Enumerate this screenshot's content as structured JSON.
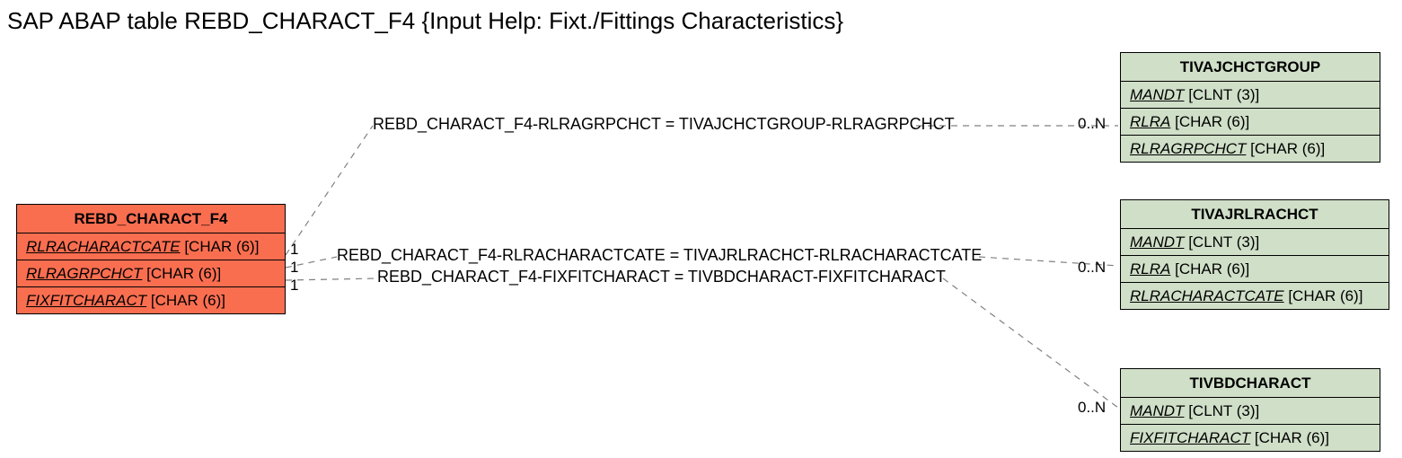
{
  "title": "SAP ABAP table REBD_CHARACT_F4 {Input Help: Fixt./Fittings Characteristics}",
  "left_entity": {
    "name": "REBD_CHARACT_F4",
    "fields": [
      {
        "name": "RLRACHARACTCATE",
        "type": "[CHAR (6)]"
      },
      {
        "name": "RLRAGRPCHCT",
        "type": "[CHAR (6)]"
      },
      {
        "name": "FIXFITCHARACT",
        "type": "[CHAR (6)]"
      }
    ]
  },
  "right_entities": [
    {
      "name": "TIVAJCHCTGROUP",
      "fields": [
        {
          "name": "MANDT",
          "type": "[CLNT (3)]"
        },
        {
          "name": "RLRA",
          "type": "[CHAR (6)]"
        },
        {
          "name": "RLRAGRPCHCT",
          "type": "[CHAR (6)]"
        }
      ]
    },
    {
      "name": "TIVAJRLRACHCT",
      "fields": [
        {
          "name": "MANDT",
          "type": "[CLNT (3)]"
        },
        {
          "name": "RLRA",
          "type": "[CHAR (6)]"
        },
        {
          "name": "RLRACHARACTCATE",
          "type": "[CHAR (6)]"
        }
      ]
    },
    {
      "name": "TIVBDCHARACT",
      "fields": [
        {
          "name": "MANDT",
          "type": "[CLNT (3)]"
        },
        {
          "name": "FIXFITCHARACT",
          "type": "[CHAR (6)]"
        }
      ]
    }
  ],
  "relations": [
    {
      "text": "REBD_CHARACT_F4-RLRAGRPCHCT = TIVAJCHCTGROUP-RLRAGRPCHCT",
      "left_card": "1",
      "right_card": "0..N"
    },
    {
      "text": "REBD_CHARACT_F4-RLRACHARACTCATE = TIVAJRLRACHCT-RLRACHARACTCATE",
      "left_card": "1",
      "right_card": "0..N"
    },
    {
      "text": "REBD_CHARACT_F4-FIXFITCHARACT = TIVBDCHARACT-FIXFITCHARACT",
      "left_card": "1",
      "right_card": "0..N"
    }
  ],
  "chart_data": {
    "type": "table",
    "title": "SAP ABAP table REBD_CHARACT_F4 {Input Help: Fixt./Fittings Characteristics}",
    "entities": [
      {
        "name": "REBD_CHARACT_F4",
        "fields": [
          "RLRACHARACTCATE CHAR(6)",
          "RLRAGRPCHCT CHAR(6)",
          "FIXFITCHARACT CHAR(6)"
        ]
      },
      {
        "name": "TIVAJCHCTGROUP",
        "fields": [
          "MANDT CLNT(3)",
          "RLRA CHAR(6)",
          "RLRAGRPCHCT CHAR(6)"
        ]
      },
      {
        "name": "TIVAJRLRACHCT",
        "fields": [
          "MANDT CLNT(3)",
          "RLRA CHAR(6)",
          "RLRACHARACTCATE CHAR(6)"
        ]
      },
      {
        "name": "TIVBDCHARACT",
        "fields": [
          "MANDT CLNT(3)",
          "FIXFITCHARACT CHAR(6)"
        ]
      }
    ],
    "relationships": [
      {
        "from": "REBD_CHARACT_F4.RLRAGRPCHCT",
        "to": "TIVAJCHCTGROUP.RLRAGRPCHCT",
        "cardinality_from": "1",
        "cardinality_to": "0..N"
      },
      {
        "from": "REBD_CHARACT_F4.RLRACHARACTCATE",
        "to": "TIVAJRLRACHCT.RLRACHARACTCATE",
        "cardinality_from": "1",
        "cardinality_to": "0..N"
      },
      {
        "from": "REBD_CHARACT_F4.FIXFITCHARACT",
        "to": "TIVBDCHARACT.FIXFITCHARACT",
        "cardinality_from": "1",
        "cardinality_to": "0..N"
      }
    ]
  }
}
